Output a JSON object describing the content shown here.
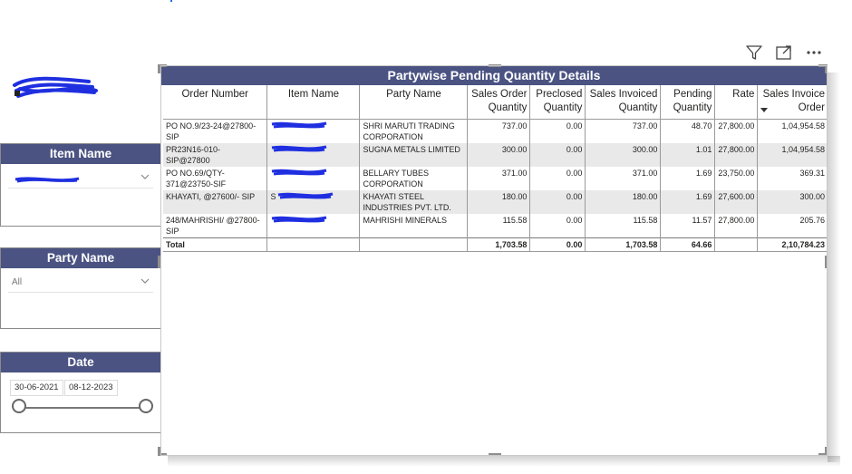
{
  "slicers": {
    "item_name": {
      "title": "Item Name",
      "selected": ""
    },
    "party_name": {
      "title": "Party Name",
      "selected": "All"
    },
    "date": {
      "title": "Date",
      "start": "30-06-2021",
      "end": "08-12-2023"
    }
  },
  "visual_header": {
    "icons": [
      "filter-icon",
      "focus-mode-icon",
      "more-options-icon"
    ]
  },
  "table": {
    "title": "Partywise Pending Quantity Details",
    "columns": [
      "Order Number",
      "Item Name",
      "Party Name",
      "Sales Order Quantity",
      "Preclosed Quantity",
      "Sales Invoiced Quantity",
      "Pending Quantity",
      "Rate",
      "Sales Invoice Order"
    ],
    "rows": [
      {
        "order_number": "PO NO.9/23-24@27800-SIP",
        "item_name": "",
        "party_name": "SHRI MARUTI TRADING CORPORATION",
        "sales_order_qty": "737.00",
        "preclosed_qty": "0.00",
        "sales_invoiced_qty": "737.00",
        "pending_qty": "48.70",
        "rate": "27,800.00",
        "sales_invoice_order": "1,04,954.58"
      },
      {
        "order_number": "PR23N16-010-SIP@27800",
        "item_name": "",
        "party_name": "SUGNA METALS LIMITED",
        "sales_order_qty": "300.00",
        "preclosed_qty": "0.00",
        "sales_invoiced_qty": "300.00",
        "pending_qty": "1.01",
        "rate": "27,800.00",
        "sales_invoice_order": "1,04,954.58"
      },
      {
        "order_number": "PO NO.69/QTY-371@23750-SIF",
        "item_name": "",
        "party_name": "BELLARY TUBES CORPORATION",
        "sales_order_qty": "371.00",
        "preclosed_qty": "0.00",
        "sales_invoiced_qty": "371.00",
        "pending_qty": "1.69",
        "rate": "23,750.00",
        "sales_invoice_order": "369.31"
      },
      {
        "order_number": "KHAYATI, @27600/- SIP",
        "item_name": "S",
        "party_name": "KHAYATI STEEL INDUSTRIES PVT. LTD.",
        "sales_order_qty": "180.00",
        "preclosed_qty": "0.00",
        "sales_invoiced_qty": "180.00",
        "pending_qty": "1.69",
        "rate": "27,600.00",
        "sales_invoice_order": "300.00"
      },
      {
        "order_number": "248/MAHRISHI/ @27800-SIP",
        "item_name": "",
        "party_name": "MAHRISHI MINERALS",
        "sales_order_qty": "115.58",
        "preclosed_qty": "0.00",
        "sales_invoiced_qty": "115.58",
        "pending_qty": "11.57",
        "rate": "27,800.00",
        "sales_invoice_order": "205.76"
      }
    ],
    "total": {
      "label": "Total",
      "sales_order_qty": "1,703.58",
      "preclosed_qty": "0.00",
      "sales_invoiced_qty": "1,703.58",
      "pending_qty": "64.66",
      "sales_invoice_order": "2,10,784.23"
    }
  }
}
